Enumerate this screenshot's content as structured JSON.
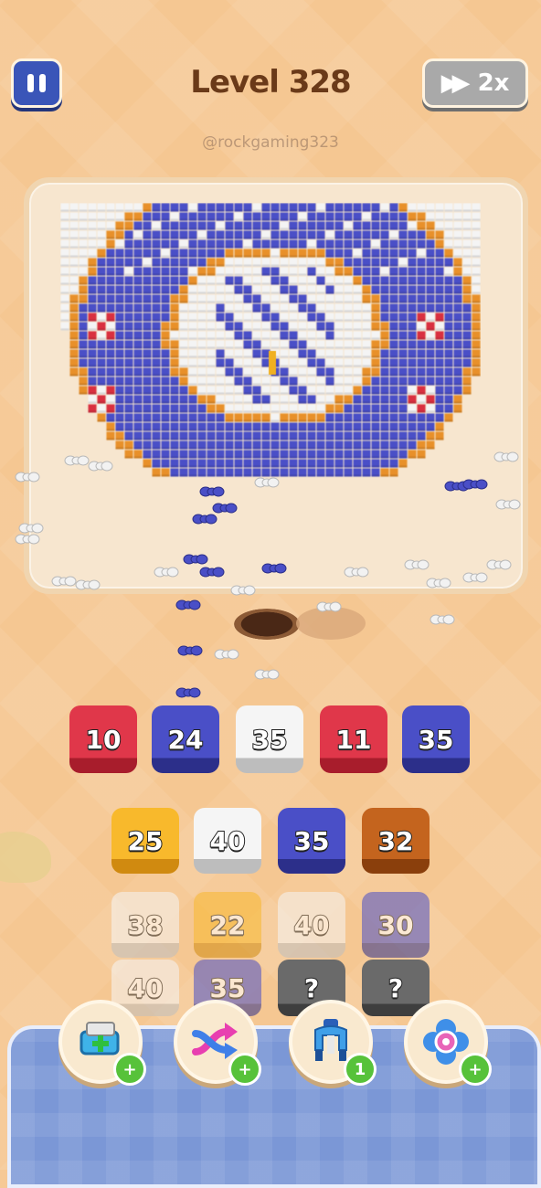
{
  "header": {
    "level_title": "Level 328",
    "speed_label": "2x",
    "watermark": "@rockgaming323"
  },
  "slots": [
    {
      "value": "10",
      "color": "red"
    },
    {
      "value": "24",
      "color": "blue"
    },
    {
      "value": "35",
      "color": "white"
    },
    {
      "value": "11",
      "color": "red"
    },
    {
      "value": "35",
      "color": "blue"
    }
  ],
  "grid": [
    [
      {
        "value": "25",
        "color": "yellow"
      },
      {
        "value": "40",
        "color": "white"
      },
      {
        "value": "35",
        "color": "blue"
      },
      {
        "value": "32",
        "color": "orange"
      }
    ],
    [
      {
        "value": "38",
        "color": "white",
        "faded": true
      },
      {
        "value": "22",
        "color": "yellow",
        "faded": true
      },
      {
        "value": "40",
        "color": "white",
        "faded": true
      },
      {
        "value": "30",
        "color": "blue",
        "faded": true
      }
    ],
    [
      {
        "value": "40",
        "color": "white",
        "faded": true
      },
      {
        "value": "35",
        "color": "blue",
        "faded": true
      },
      {
        "value": "?",
        "color": "gray"
      },
      {
        "value": "?",
        "color": "gray"
      }
    ]
  ],
  "boosters": [
    {
      "name": "add-slot-booster",
      "icon": "tray-plus-icon",
      "badge": "+"
    },
    {
      "name": "shuffle-booster",
      "icon": "shuffle-arrows-icon",
      "badge": "+"
    },
    {
      "name": "magnet-booster",
      "icon": "magnet-icon",
      "badge": "1"
    },
    {
      "name": "flower-booster",
      "icon": "flower-icon",
      "badge": "+"
    }
  ],
  "colors": {
    "red": "#e0374a",
    "blue": "#4a4fc7",
    "white": "#f5f5f5",
    "orange": "#c4641e",
    "yellow": "#f8b92c",
    "gray": "#6a6a6a",
    "background": "#f5c792",
    "tray": "#7b97d6"
  }
}
